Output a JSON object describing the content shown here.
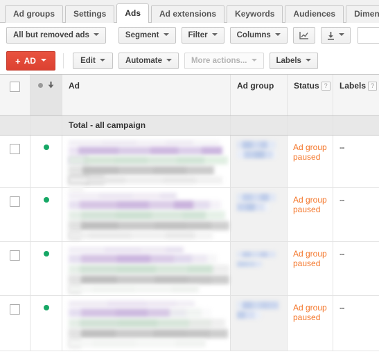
{
  "tabs": [
    {
      "label": "Ad groups",
      "active": false
    },
    {
      "label": "Settings",
      "active": false
    },
    {
      "label": "Ads",
      "active": true
    },
    {
      "label": "Ad extensions",
      "active": false
    },
    {
      "label": "Keywords",
      "active": false
    },
    {
      "label": "Audiences",
      "active": false
    },
    {
      "label": "Dimensions",
      "active": false
    }
  ],
  "tab_overflow": {
    "icon": "chevron-down-icon"
  },
  "toolbar_filters": {
    "view_selector": "All but removed ads",
    "segment": "Segment",
    "filter": "Filter",
    "columns": "Columns",
    "chart_icon": "chart-line-icon",
    "download_icon": "download-icon",
    "search_value": "",
    "search_placeholder": ""
  },
  "toolbar_actions": {
    "add_ad": "AD",
    "add_ad_plus": "+",
    "edit": "Edit",
    "automate": "Automate",
    "more_actions": "More actions...",
    "labels": "Labels"
  },
  "table": {
    "columns": {
      "checkbox": "",
      "status_sort": "",
      "ad": "Ad",
      "ad_group": "Ad group",
      "status": "Status",
      "labels": "Labels",
      "help_glyph": "?"
    },
    "total_row_label": "Total - all campaign",
    "rows": [
      {
        "status_dot": "enabled",
        "status": "Ad group paused",
        "labels": "--",
        "ad_redacted": true,
        "ad_group_redacted": true
      },
      {
        "status_dot": "enabled",
        "status": "Ad group paused",
        "labels": "--",
        "ad_redacted": true,
        "ad_group_redacted": true
      },
      {
        "status_dot": "enabled",
        "status": "Ad group paused",
        "labels": "--",
        "ad_redacted": true,
        "ad_group_redacted": true
      },
      {
        "status_dot": "enabled",
        "status": "Ad group paused",
        "labels": "--",
        "ad_redacted": true,
        "ad_group_redacted": true
      }
    ]
  },
  "colors": {
    "accent_red": "#dc4131",
    "status_orange": "#f4762a",
    "enabled_green": "#16a765",
    "link_blue": "#3b73c4",
    "chrome_gray": "#f1f1f1",
    "border_gray": "#c6c6c6"
  }
}
